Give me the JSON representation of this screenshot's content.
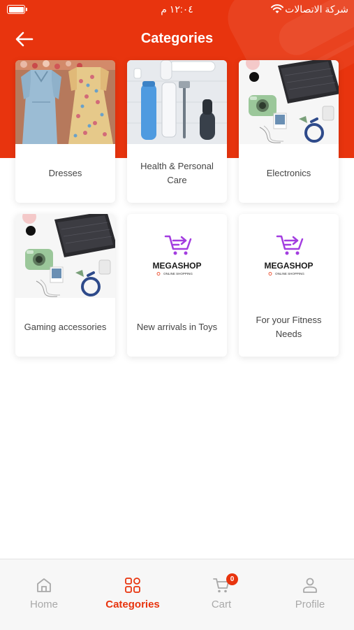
{
  "status_bar": {
    "time": "١٢:٠٤ م",
    "carrier": "شركة الاتصالات"
  },
  "header": {
    "title": "Categories"
  },
  "categories": [
    {
      "label": "Dresses",
      "image": "dresses-photo"
    },
    {
      "label": "Health & Personal Care",
      "image": "personal-care-photo"
    },
    {
      "label": "Electronics",
      "image": "electronics-photo"
    },
    {
      "label": "Gaming accessories",
      "image": "electronics-photo"
    },
    {
      "label": "New arrivals in Toys",
      "image": "megashop-logo"
    },
    {
      "label": "For your Fitness Needs",
      "image": "megashop-logo"
    }
  ],
  "megashop_logo": {
    "name": "MEGASHOP",
    "tagline": "ONLINE SHOPPING"
  },
  "bottom_nav": {
    "items": [
      {
        "label": "Home",
        "icon": "home-icon",
        "active": false
      },
      {
        "label": "Categories",
        "icon": "grid-icon",
        "active": true
      },
      {
        "label": "Cart",
        "icon": "cart-icon",
        "active": false,
        "badge": "0"
      },
      {
        "label": "Profile",
        "icon": "user-icon",
        "active": false
      }
    ]
  },
  "colors": {
    "accent": "#e8340e",
    "nav_inactive": "#a9a9a9",
    "text": "#444444"
  }
}
